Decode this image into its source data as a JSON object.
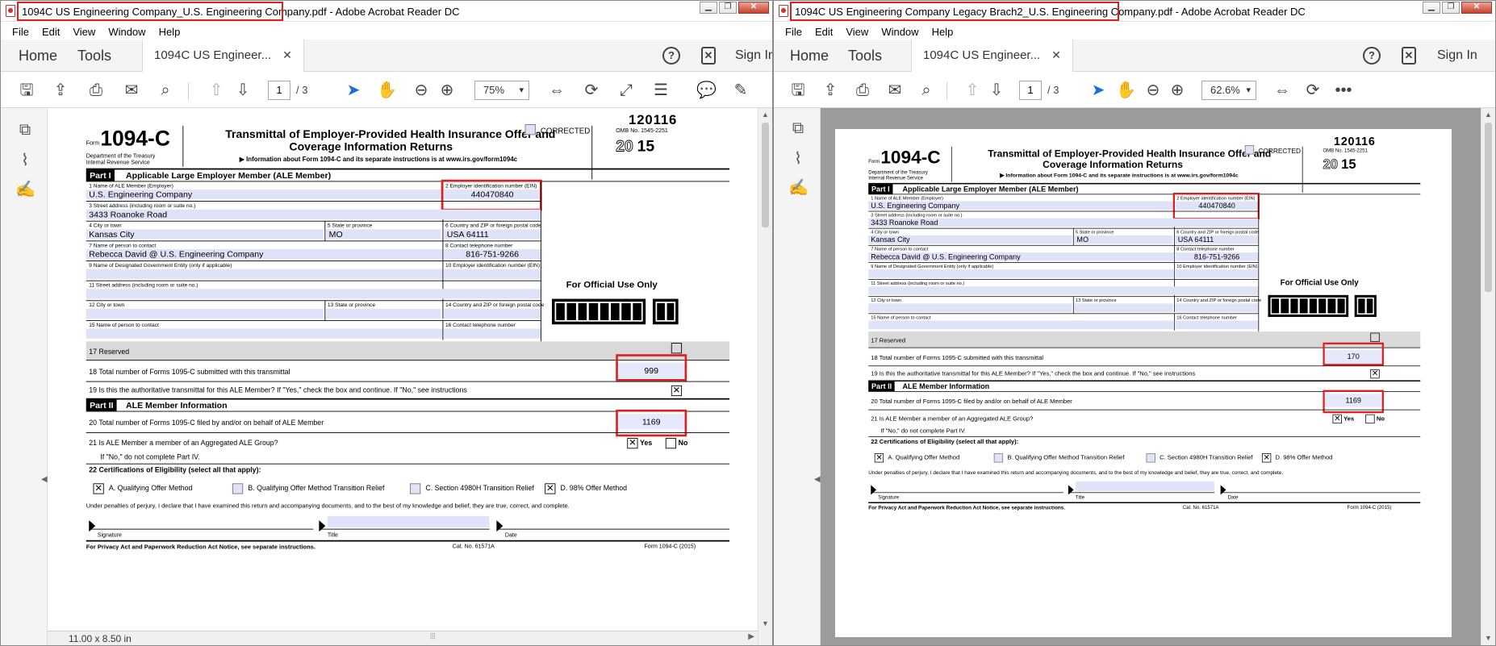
{
  "window_left": {
    "title": "1094C US Engineering Company_U.S. Engineering Company.pdf - Adobe Acrobat Reader DC",
    "zoom": "75%",
    "page_number": "1",
    "page_total": "/ 3",
    "status_size": "11.00 x 8.50 in"
  },
  "window_right": {
    "title": "1094C US Engineering Company Legacy Brach2_U.S. Engineering Company.pdf - Adobe Acrobat Reader DC",
    "zoom": "62.6%",
    "page_number": "1",
    "page_total": "/ 3"
  },
  "menu": [
    "File",
    "Edit",
    "View",
    "Window",
    "Help"
  ],
  "nav": {
    "home": "Home",
    "tools": "Tools",
    "doc_tab": "1094C US Engineer...",
    "sign_in": "Sign In"
  },
  "form": {
    "top_code": "120116",
    "form_prefix": "Form",
    "form_number": "1094-C",
    "dept_line1": "Department of the Treasury",
    "dept_line2": "Internal Revenue Service",
    "title1": "Transmittal of Employer-Provided Health Insurance Offer and",
    "title2": "Coverage Information Returns",
    "subtitle": "▶ Information about Form 1094-C and its separate instructions is at www.irs.gov/form1094c",
    "corrected": "CORRECTED",
    "omb": "OMB No. 1545-2251",
    "year_outline": "20",
    "year_bold": "15",
    "part1_tag": "Part I",
    "part1_title": "Applicable Large Employer Member (ALE Member)",
    "l1_label": "1  Name of ALE Member (Employer)",
    "l2_label": "2 Employer identification number (EIN)",
    "l3_label": "3  Street address (including room or suite no.)",
    "l4_label": "4  City or town",
    "l5_label": "5  State or province",
    "l6_label": "6 Country and ZIP or foreign postal code",
    "l7_label": "7  Name of person to contact",
    "l8_label": "8 Contact telephone number",
    "l9_label": "9  Name of Designated Government Entity (only if applicable)",
    "l10_label": "10 Employer identification number (EIN)",
    "l11_label": "11  Street address (including room or suite no.)",
    "l12_label": "12  City or town",
    "l13_label": "13  State or province",
    "l14_label": "14  Country and ZIP or foreign postal code",
    "l15_label": "15  Name of person to contact",
    "l16_label": "16  Contact telephone number",
    "official_use": "For Official Use Only",
    "l17": "17  Reserved",
    "l18": "18  Total number of Forms 1095-C submitted with this transmittal",
    "l19": "19  Is this the authoritative transmittal for this ALE Member? If \"Yes,\" check the box and continue. If \"No,\" see instructions",
    "part2_tag": "Part II",
    "part2_title": "ALE Member Information",
    "l20": "20  Total number of Forms 1095-C filed by and/or on behalf of ALE Member",
    "l21": "21  Is ALE Member a member of an Aggregated ALE Group?",
    "l21_note": "If \"No,\" do not complete Part IV.",
    "yes": "Yes",
    "no": "No",
    "l22": "22  Certifications of Eligibility (select all that apply):",
    "cert_a": "A. Qualifying Offer Method",
    "cert_b": "B. Qualifying Offer Method Transition Relief",
    "cert_c": "C. Section 4980H Transition Relief",
    "cert_d": "D. 98% Offer Method",
    "perjury": "Under penalties of perjury, I declare that I have examined this return and accompanying documents, and to the best of my knowledge and belief, they are true, correct, and complete.",
    "signature": "Signature",
    "title_lbl": "Title",
    "date_lbl": "Date",
    "privacy": "For Privacy Act and Paperwork Reduction Act Notice, see separate instructions.",
    "cat_no": "Cat. No. 61571A",
    "form_footer": "Form 1094-C (2015)",
    "check_mark": "✕"
  },
  "data_left": {
    "name": "U.S. Engineering Company",
    "ein": "440470840",
    "street": "3433 Roanoke Road",
    "city": "Kansas City",
    "state": "MO",
    "country_zip": "USA 64111",
    "contact": "Rebecca David @ U.S. Engineering Company",
    "phone": "816-751-9266",
    "total_18": "999",
    "total_20": "1169"
  },
  "data_right": {
    "name": "U.S. Engineering Company",
    "ein": "440470840",
    "street": "3433 Roanoke Road",
    "city": "Kansas City",
    "state": "MO",
    "country_zip": "USA 64111",
    "contact": "Rebecca David @ U.S. Engineering Company",
    "phone": "816-751-9266",
    "total_18": "170",
    "total_20": "1169"
  }
}
